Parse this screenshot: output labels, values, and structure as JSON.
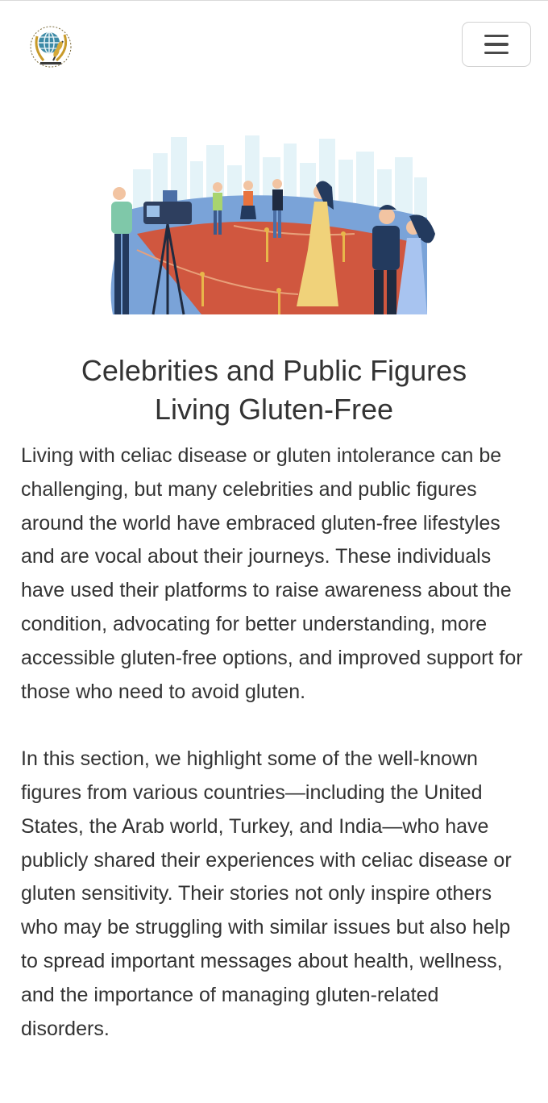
{
  "header": {
    "logo_icon": "globe-wheat-emblem-icon",
    "menu_icon": "hamburger-menu-icon"
  },
  "hero": {
    "illustration": "celebrities-red-carpet-illustration"
  },
  "article": {
    "title_line1": "Celebrities and Public Figures",
    "title_line2": "Living Gluten-Free",
    "paragraph1": "Living with celiac disease or gluten intolerance can be challenging, but many celebrities and public figures around the world have embraced gluten-free lifestyles and are vocal about their journeys. These individuals have used their platforms to raise awareness about the condition, advocating for better understanding, more accessible gluten-free options, and improved support for those who need to avoid gluten.",
    "paragraph2": "In this section, we highlight some of the well-known figures from various countries—including the United States, the Arab world, Turkey, and India—who have publicly shared their experiences with celiac disease or gluten sensitivity. Their stories not only inspire others who may be struggling with similar issues but also help to spread important messages about health, wellness, and the importance of managing gluten-related disorders."
  },
  "colors": {
    "text": "#333333",
    "red_carpet": "#d0573f",
    "sky": "#e6f4f8",
    "stage_blue": "#7aa3d8"
  }
}
